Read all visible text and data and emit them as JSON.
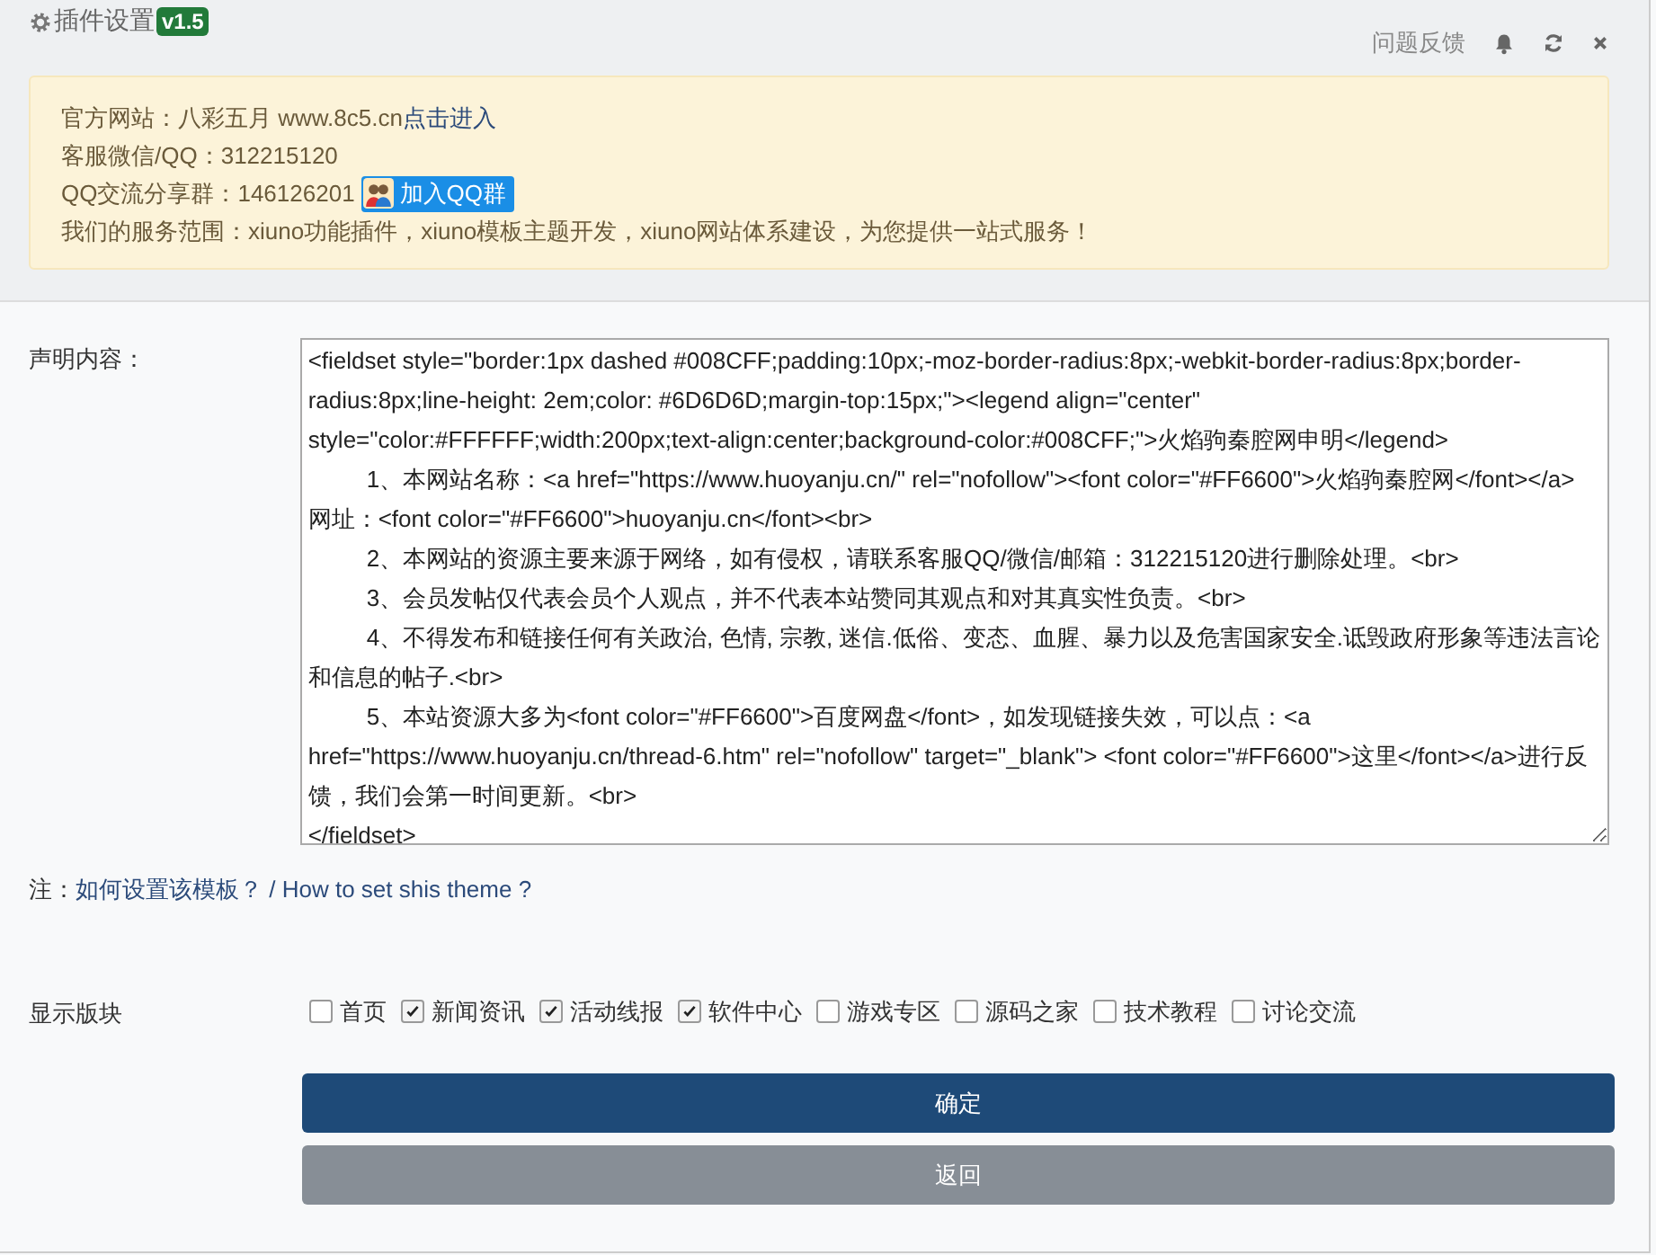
{
  "header": {
    "title": "插件设置",
    "version": "v1.5",
    "feedback": "问题反馈"
  },
  "notice": {
    "lines": [
      {
        "kind": "link",
        "label": "官方网站：八彩五月 www.8c5.cn",
        "link": "点击进入"
      },
      {
        "kind": "text",
        "label": "客服微信/QQ：312215120"
      },
      {
        "kind": "button",
        "label": "QQ交流分享群：146126201",
        "button": "加入QQ群"
      },
      {
        "kind": "text",
        "label": "我们的服务范围：xiuno功能插件，xiuno模板主题开发，xiuno网站体系建设，为您提供一站式服务！"
      }
    ]
  },
  "statement": {
    "label": "声明内容：",
    "value": "<fieldset style=\"border:1px dashed #008CFF;padding:10px;-moz-border-radius:8px;-webkit-border-radius:8px;border-radius:8px;line-height: 2em;color: #6D6D6D;margin-top:15px;\"><legend align=\"center\" style=\"color:#FFFFFF;width:200px;text-align:center;background-color:#008CFF;\">火焰驹秦腔网申明</legend>\n\t1、本网站名称：<a href=\"https://www.huoyanju.cn/\" rel=\"nofollow\"><font color=\"#FF6600\">火焰驹秦腔网</font></a>  网址：<font color=\"#FF6600\">huoyanju.cn</font><br>\n\t2、本网站的资源主要来源于网络，如有侵权，请联系客服QQ/微信/邮箱：312215120进行删除处理。<br>\n\t3、会员发帖仅代表会员个人观点，并不代表本站赞同其观点和对其真实性负责。<br>\n\t4、不得发布和链接任何有关政治, 色情, 宗教, 迷信.低俗、变态、血腥、暴力以及危害国家安全.诋毁政府形象等违法言论和信息的帖子.<br>\n\t5、本站资源大多为<font color=\"#FF6600\">百度网盘</font>，如发现链接失效，可以点：<a href=\"https://www.huoyanju.cn/thread-6.htm\" rel=\"nofollow\" target=\"_blank\"> <font color=\"#FF6600\">这里</font></a>进行反馈，我们会第一时间更新。<br>\n</fieldset>"
  },
  "note": {
    "prefix": "注：",
    "link": "如何设置该模板？ / How to set shis theme ?"
  },
  "sections": {
    "label": "显示版块",
    "items": [
      {
        "label": "首页",
        "checked": false
      },
      {
        "label": "新闻资讯",
        "checked": true
      },
      {
        "label": "活动线报",
        "checked": true
      },
      {
        "label": "软件中心",
        "checked": true
      },
      {
        "label": "游戏专区",
        "checked": false
      },
      {
        "label": "源码之家",
        "checked": false
      },
      {
        "label": "技术教程",
        "checked": false
      },
      {
        "label": "讨论交流",
        "checked": false
      }
    ]
  },
  "buttons": [
    {
      "kind": "primary",
      "label": "确定"
    },
    {
      "kind": "secondary",
      "label": "返回"
    }
  ]
}
